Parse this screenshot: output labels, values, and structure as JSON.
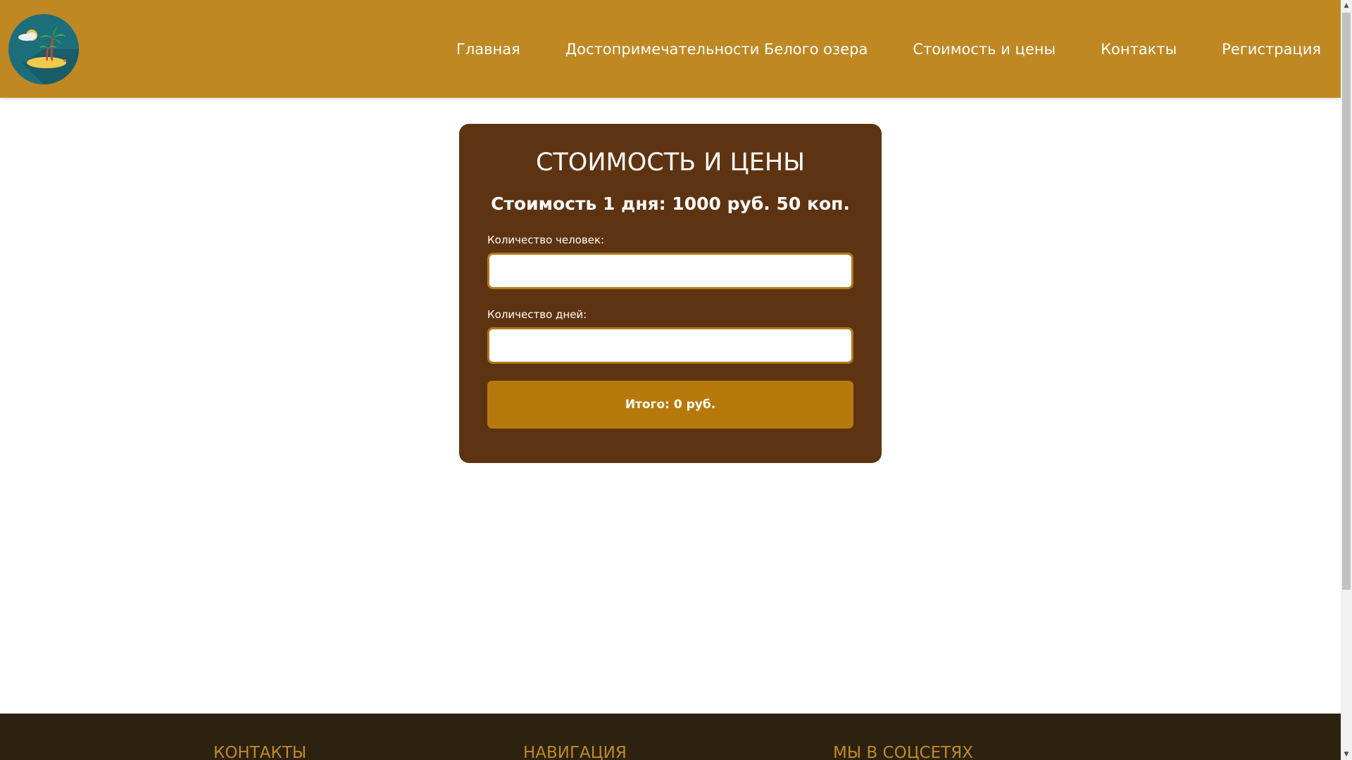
{
  "header": {
    "nav": [
      {
        "label": "Главная"
      },
      {
        "label": "Достопримечательности Белого озера"
      },
      {
        "label": "Стоимость и цены"
      },
      {
        "label": "Контакты"
      },
      {
        "label": "Регистрация"
      }
    ]
  },
  "main": {
    "title": "СТОИМОСТЬ И ЦЕНЫ",
    "price_per_day": "Стоимость 1 дня: 1000 руб. 50 коп.",
    "people_label": "Количество человек:",
    "people_value": "",
    "days_label": "Количество дней:",
    "days_value": "",
    "total_label": "Итого: 0 руб."
  },
  "footer": {
    "contacts_heading": "Контакты",
    "navigation_heading": "Навигация",
    "social_heading": "Мы в соцсетях"
  },
  "colors": {
    "header_bg": "#bf8823",
    "card_bg": "#5e3311",
    "button_bg": "#b8790c",
    "footer_bg": "#2c220f",
    "footer_heading": "#c0882a"
  },
  "icons": {
    "logo": "island-palm-logo-icon",
    "scroll_up": "scroll-up-arrow-icon",
    "scroll_down": "scroll-down-arrow-icon"
  }
}
